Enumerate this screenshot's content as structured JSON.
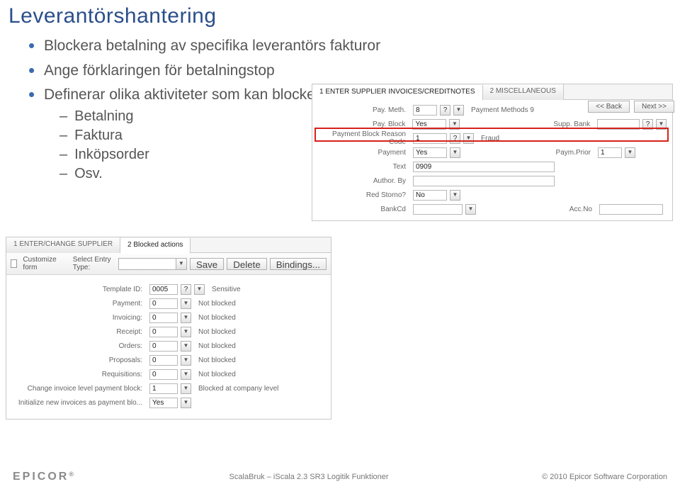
{
  "title": "Leverantörshantering",
  "bullets": {
    "b1": "Blockera betalning av specifika leverantörs fakturor",
    "b2": "Ange förklaringen för betalningstop",
    "b3": "Definerar olika aktiviteter som kan blockeras eller tillåtas:",
    "sub1": "Betalning",
    "sub2": "Faktura",
    "sub3": "Inköpsorder",
    "sub4": "Osv."
  },
  "panel_right": {
    "tab1": "1 ENTER SUPPLIER INVOICES/CREDITNOTES",
    "tab2": "2 MISCELLANEOUS",
    "btn_back": "<< Back",
    "btn_next": "Next >>",
    "rows": {
      "pay_meth_lab": "Pay. Meth.",
      "pay_meth_val": "8",
      "pay_meth_after": "Payment Methods 9",
      "pay_block_lab": "Pay. Block",
      "pay_block_val": "Yes",
      "supp_bank_lab": "Supp. Bank",
      "pbrc_lab": "Payment Block Reason Code",
      "pbrc_val": "1",
      "pbrc_after": "Fraud",
      "payment_lab": "Payment",
      "payment_val": "Yes",
      "paym_prior_lab": "Paym.Prior",
      "paym_prior_val": "1",
      "text_lab": "Text",
      "text_val": "0909",
      "author_lab": "Author. By",
      "red_lab": "Red Storno?",
      "red_val": "No",
      "bankcd_lab": "BankCd",
      "accno_lab": "Acc.No"
    }
  },
  "panel_left": {
    "tab1": "1 ENTER/CHANGE SUPPLIER",
    "tab2": "2 Blocked actions",
    "customize": "Customize form",
    "select_entry": "Select Entry Type:",
    "btn_save": "Save",
    "btn_delete": "Delete",
    "btn_bindings": "Bindings...",
    "rows": {
      "template_lab": "Template ID:",
      "template_val": "0005",
      "template_after": "Sensitive",
      "payment_lab": "Payment:",
      "invoicing_lab": "Invoicing:",
      "receipt_lab": "Receipt:",
      "orders_lab": "Orders:",
      "proposals_lab": "Proposals:",
      "requisitions_lab": "Requisitions:",
      "zero_val": "0",
      "not_blocked": "Not blocked",
      "change_lab": "Change invoice level payment block:",
      "change_val": "1",
      "change_after": "Blocked at company level",
      "init_lab": "Initialize new invoices as payment blo...",
      "init_val": "Yes"
    }
  },
  "footer": {
    "logo": "EPICOR",
    "center": "ScalaBruk – iScala 2.3 SR3 Logitik Funktioner",
    "right": "© 2010 Epicor Software Corporation"
  }
}
